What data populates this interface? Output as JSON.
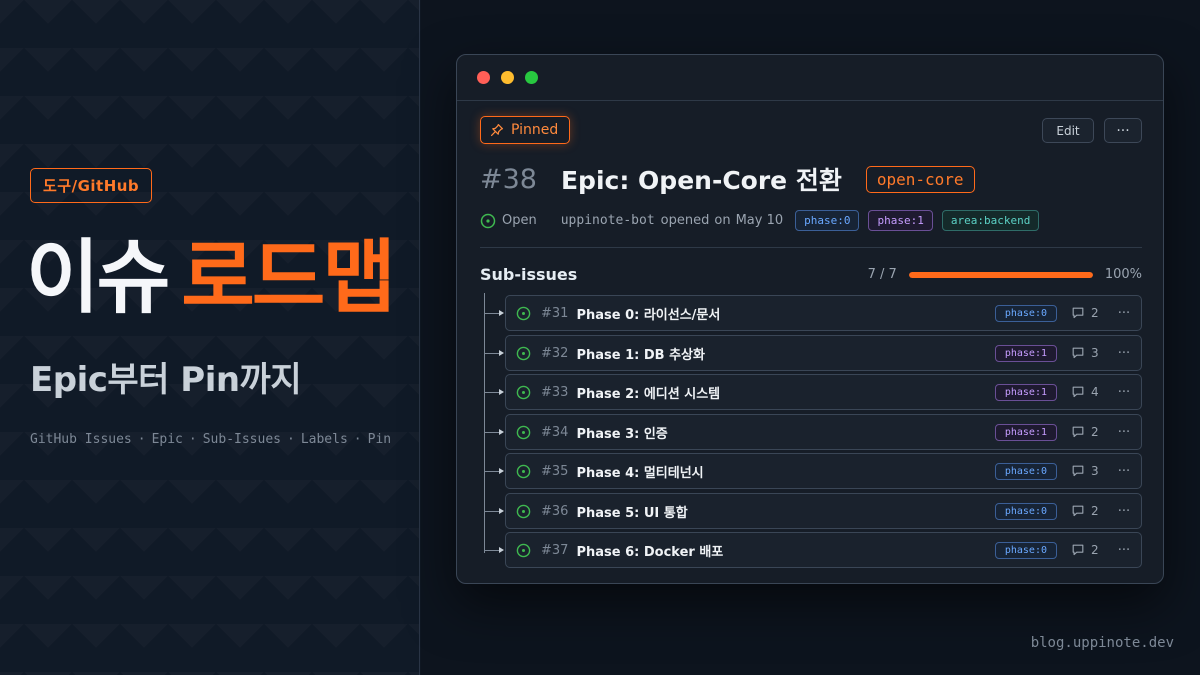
{
  "hero": {
    "category": "도구/GitHub",
    "title_white": "이슈",
    "title_orange": "로드맵",
    "subtitle": "Epic부터 Pin까지",
    "tags": [
      "GitHub Issues",
      "Epic",
      "Sub-Issues",
      "Labels",
      "Pin"
    ],
    "separator": "·"
  },
  "footer": {
    "site": "blog.uppinote.dev"
  },
  "window": {
    "pinned_label": "Pinned",
    "edit_label": "Edit",
    "more_label": "···",
    "issue": {
      "number": "#38",
      "title": "Epic: Open-Core 전환",
      "label": "open-core",
      "state": "Open",
      "author": "uppinote-bot",
      "action": "opened",
      "on": "on",
      "date": "May 10",
      "chips": [
        {
          "text": "phase:0",
          "color": "blue"
        },
        {
          "text": "phase:1",
          "color": "purple"
        },
        {
          "text": "area:backend",
          "color": "teal"
        }
      ]
    },
    "sub_issues": {
      "heading": "Sub-issues",
      "count": "7 / 7",
      "progress": 1.0,
      "percent": "100%",
      "items": [
        {
          "number": "#31",
          "title": "Phase 0: 라이선스/문서",
          "label": "phase:0",
          "color": "blue",
          "comments": "2"
        },
        {
          "number": "#32",
          "title": "Phase 1: DB 추상화",
          "label": "phase:1",
          "color": "purple",
          "comments": "3"
        },
        {
          "number": "#33",
          "title": "Phase 2: 에디션 시스템",
          "label": "phase:1",
          "color": "purple",
          "comments": "4"
        },
        {
          "number": "#34",
          "title": "Phase 3: 인증",
          "label": "phase:1",
          "color": "purple",
          "comments": "2"
        },
        {
          "number": "#35",
          "title": "Phase 4: 멀티테넌시",
          "label": "phase:0",
          "color": "blue",
          "comments": "3"
        },
        {
          "number": "#36",
          "title": "Phase 5: UI 통합",
          "label": "phase:0",
          "color": "blue",
          "comments": "2"
        },
        {
          "number": "#37",
          "title": "Phase 6: Docker 배포",
          "label": "phase:0",
          "color": "blue",
          "comments": "2"
        }
      ]
    }
  },
  "colors": {
    "accent": "#ff6a1a",
    "open_green": "#3fb950",
    "background": "#0f1722"
  }
}
